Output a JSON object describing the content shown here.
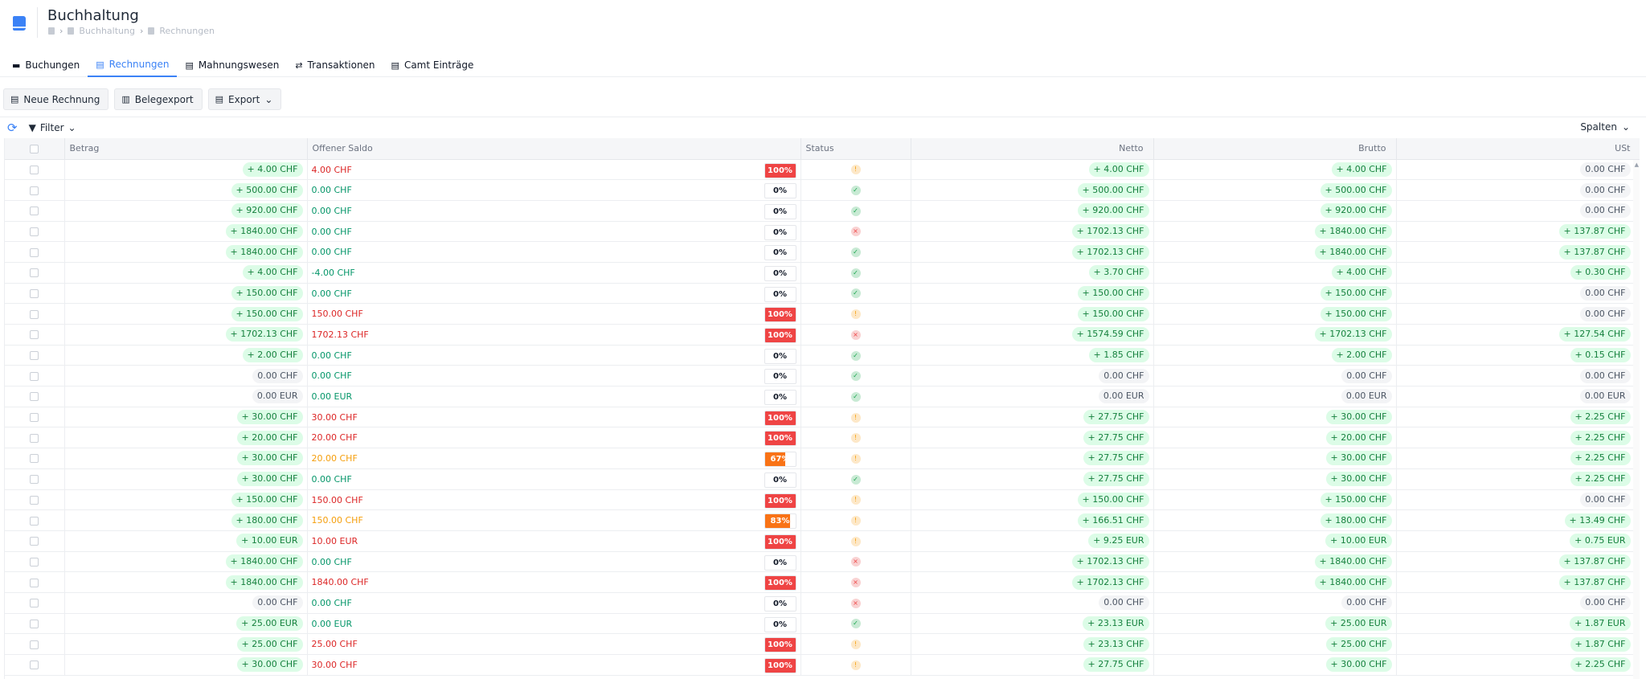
{
  "header": {
    "title": "Buchhaltung",
    "breadcrumb": [
      "Buchhaltung",
      "Rechnungen"
    ]
  },
  "tabs": [
    {
      "label": "Buchungen",
      "icon": "ticket-icon",
      "glyph": "▬",
      "active": false
    },
    {
      "label": "Rechnungen",
      "icon": "document-icon",
      "glyph": "▤",
      "active": true
    },
    {
      "label": "Mahnungswesen",
      "icon": "document-alert-icon",
      "glyph": "▤",
      "active": false
    },
    {
      "label": "Transaktionen",
      "icon": "arrows-exchange-icon",
      "glyph": "⇄",
      "active": false
    },
    {
      "label": "Camt Einträge",
      "icon": "document-icon",
      "glyph": "▤",
      "active": false
    }
  ],
  "toolbar": {
    "new_invoice": "Neue Rechnung",
    "receipt_export": "Belegexport",
    "export": "Export"
  },
  "filterbar": {
    "filter": "Filter",
    "columns": "Spalten"
  },
  "columns": {
    "betrag": "Betrag",
    "saldo": "Offener Saldo",
    "status": "Status",
    "netto": "Netto",
    "brutto": "Brutto",
    "ust": "USt"
  },
  "colors": {
    "accent": "#3b82f6",
    "positive": "#15803d",
    "negative": "#dc2626",
    "partial": "#f59e0b"
  },
  "rows": [
    {
      "betrag": "+ 4.00 CHF",
      "saldo": "4.00 CHF",
      "saldo_color": "red",
      "pct_label": "100%",
      "pct": 100,
      "status": "open",
      "netto": "+ 4.00 CHF",
      "brutto": "+ 4.00 CHF",
      "ust": "0.00 CHF"
    },
    {
      "betrag": "+ 500.00 CHF",
      "saldo": "0.00 CHF",
      "saldo_color": "green",
      "pct_label": "0%",
      "pct": 0,
      "status": "paid",
      "netto": "+ 500.00 CHF",
      "brutto": "+ 500.00 CHF",
      "ust": "0.00 CHF"
    },
    {
      "betrag": "+ 920.00 CHF",
      "saldo": "0.00 CHF",
      "saldo_color": "green",
      "pct_label": "0%",
      "pct": 0,
      "status": "paid",
      "netto": "+ 920.00 CHF",
      "brutto": "+ 920.00 CHF",
      "ust": "0.00 CHF"
    },
    {
      "betrag": "+ 1840.00 CHF",
      "saldo": "0.00 CHF",
      "saldo_color": "green",
      "pct_label": "0%",
      "pct": 0,
      "status": "cancelled",
      "netto": "+ 1702.13 CHF",
      "brutto": "+ 1840.00 CHF",
      "ust": "+ 137.87 CHF"
    },
    {
      "betrag": "+ 1840.00 CHF",
      "saldo": "0.00 CHF",
      "saldo_color": "green",
      "pct_label": "0%",
      "pct": 0,
      "status": "paid",
      "netto": "+ 1702.13 CHF",
      "brutto": "+ 1840.00 CHF",
      "ust": "+ 137.87 CHF"
    },
    {
      "betrag": "+ 4.00 CHF",
      "saldo": "-4.00 CHF",
      "saldo_color": "green",
      "pct_label": "0%",
      "pct": 0,
      "status": "paid",
      "netto": "+ 3.70 CHF",
      "brutto": "+ 4.00 CHF",
      "ust": "+ 0.30 CHF"
    },
    {
      "betrag": "+ 150.00 CHF",
      "saldo": "0.00 CHF",
      "saldo_color": "green",
      "pct_label": "0%",
      "pct": 0,
      "status": "paid",
      "netto": "+ 150.00 CHF",
      "brutto": "+ 150.00 CHF",
      "ust": "0.00 CHF"
    },
    {
      "betrag": "+ 150.00 CHF",
      "saldo": "150.00 CHF",
      "saldo_color": "red",
      "pct_label": "100%",
      "pct": 100,
      "status": "open",
      "netto": "+ 150.00 CHF",
      "brutto": "+ 150.00 CHF",
      "ust": "0.00 CHF"
    },
    {
      "betrag": "+ 1702.13 CHF",
      "saldo": "1702.13 CHF",
      "saldo_color": "red",
      "pct_label": "100%",
      "pct": 100,
      "status": "cancelled",
      "netto": "+ 1574.59 CHF",
      "brutto": "+ 1702.13 CHF",
      "ust": "+ 127.54 CHF"
    },
    {
      "betrag": "+ 2.00 CHF",
      "saldo": "0.00 CHF",
      "saldo_color": "green",
      "pct_label": "0%",
      "pct": 0,
      "status": "paid",
      "netto": "+ 1.85 CHF",
      "brutto": "+ 2.00 CHF",
      "ust": "+ 0.15 CHF"
    },
    {
      "betrag": "0.00 CHF",
      "saldo": "0.00 CHF",
      "saldo_color": "green",
      "pct_label": "0%",
      "pct": 0,
      "status": "paid",
      "netto": "0.00 CHF",
      "brutto": "0.00 CHF",
      "ust": "0.00 CHF"
    },
    {
      "betrag": "0.00 EUR",
      "saldo": "0.00 EUR",
      "saldo_color": "green",
      "pct_label": "0%",
      "pct": 0,
      "status": "paid",
      "netto": "0.00 EUR",
      "brutto": "0.00 EUR",
      "ust": "0.00 EUR"
    },
    {
      "betrag": "+ 30.00 CHF",
      "saldo": "30.00 CHF",
      "saldo_color": "red",
      "pct_label": "100%",
      "pct": 100,
      "status": "open",
      "netto": "+ 27.75 CHF",
      "brutto": "+ 30.00 CHF",
      "ust": "+ 2.25 CHF"
    },
    {
      "betrag": "+ 20.00 CHF",
      "saldo": "20.00 CHF",
      "saldo_color": "red",
      "pct_label": "100%",
      "pct": 100,
      "status": "open",
      "netto": "+ 27.75 CHF",
      "brutto": "+ 20.00 CHF",
      "ust": "+ 2.25 CHF"
    },
    {
      "betrag": "+ 30.00 CHF",
      "saldo": "20.00 CHF",
      "saldo_color": "orange",
      "pct_label": "67%",
      "pct": 67,
      "status": "open",
      "netto": "+ 27.75 CHF",
      "brutto": "+ 30.00 CHF",
      "ust": "+ 2.25 CHF"
    },
    {
      "betrag": "+ 30.00 CHF",
      "saldo": "0.00 CHF",
      "saldo_color": "green",
      "pct_label": "0%",
      "pct": 0,
      "status": "paid",
      "netto": "+ 27.75 CHF",
      "brutto": "+ 30.00 CHF",
      "ust": "+ 2.25 CHF"
    },
    {
      "betrag": "+ 150.00 CHF",
      "saldo": "150.00 CHF",
      "saldo_color": "red",
      "pct_label": "100%",
      "pct": 100,
      "status": "open",
      "netto": "+ 150.00 CHF",
      "brutto": "+ 150.00 CHF",
      "ust": "0.00 CHF"
    },
    {
      "betrag": "+ 180.00 CHF",
      "saldo": "150.00 CHF",
      "saldo_color": "orange",
      "pct_label": "83%",
      "pct": 83,
      "status": "open",
      "netto": "+ 166.51 CHF",
      "brutto": "+ 180.00 CHF",
      "ust": "+ 13.49 CHF"
    },
    {
      "betrag": "+ 10.00 EUR",
      "saldo": "10.00 EUR",
      "saldo_color": "red",
      "pct_label": "100%",
      "pct": 100,
      "status": "open",
      "netto": "+ 9.25 EUR",
      "brutto": "+ 10.00 EUR",
      "ust": "+ 0.75 EUR"
    },
    {
      "betrag": "+ 1840.00 CHF",
      "saldo": "0.00 CHF",
      "saldo_color": "green",
      "pct_label": "0%",
      "pct": 0,
      "status": "cancelled",
      "netto": "+ 1702.13 CHF",
      "brutto": "+ 1840.00 CHF",
      "ust": "+ 137.87 CHF"
    },
    {
      "betrag": "+ 1840.00 CHF",
      "saldo": "1840.00 CHF",
      "saldo_color": "red",
      "pct_label": "100%",
      "pct": 100,
      "status": "cancelled",
      "netto": "+ 1702.13 CHF",
      "brutto": "+ 1840.00 CHF",
      "ust": "+ 137.87 CHF"
    },
    {
      "betrag": "0.00 CHF",
      "saldo": "0.00 CHF",
      "saldo_color": "green",
      "pct_label": "0%",
      "pct": 0,
      "status": "cancelled",
      "netto": "0.00 CHF",
      "brutto": "0.00 CHF",
      "ust": "0.00 CHF"
    },
    {
      "betrag": "+ 25.00 EUR",
      "saldo": "0.00 EUR",
      "saldo_color": "green",
      "pct_label": "0%",
      "pct": 0,
      "status": "paid",
      "netto": "+ 23.13 EUR",
      "brutto": "+ 25.00 EUR",
      "ust": "+ 1.87 EUR"
    },
    {
      "betrag": "+ 25.00 CHF",
      "saldo": "25.00 CHF",
      "saldo_color": "red",
      "pct_label": "100%",
      "pct": 100,
      "status": "open",
      "netto": "+ 23.13 CHF",
      "brutto": "+ 25.00 CHF",
      "ust": "+ 1.87 CHF"
    },
    {
      "betrag": "+ 30.00 CHF",
      "saldo": "30.00 CHF",
      "saldo_color": "red",
      "pct_label": "100%",
      "pct": 100,
      "status": "open",
      "netto": "+ 27.75 CHF",
      "brutto": "+ 30.00 CHF",
      "ust": "+ 2.25 CHF"
    }
  ]
}
